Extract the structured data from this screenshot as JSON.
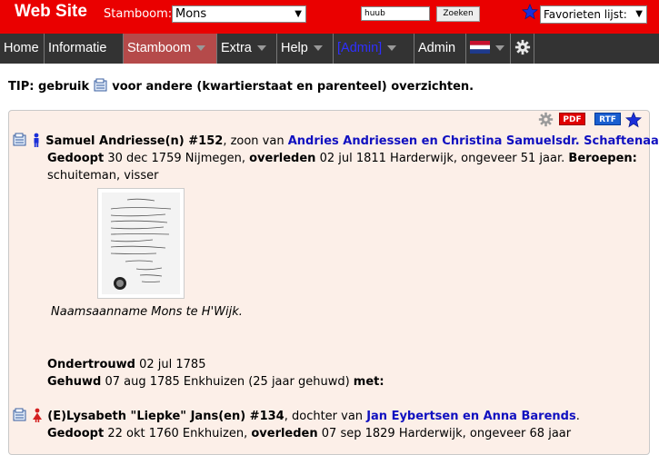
{
  "header": {
    "site_title": "Web Site",
    "stamboom_label": "Stamboom:",
    "stamboom_value": "Mons",
    "search_value": "huub",
    "search_button": "Zoeken",
    "favorites_value": "Favorieten lijst:",
    "bg_color": "#ea0000"
  },
  "nav": {
    "items": [
      {
        "label": "Home"
      },
      {
        "label": "Informatie"
      },
      {
        "label": "Stamboom"
      },
      {
        "label": "Extra"
      },
      {
        "label": "Help"
      },
      {
        "label": "[Admin]"
      },
      {
        "label": "Admin"
      }
    ],
    "active": "Stamboom",
    "flag_icon": "dutch-flag-icon",
    "gear_icon": "gear-icon"
  },
  "tip": {
    "prefix": "TIP: gebruik",
    "suffix": "voor andere (kwartierstaat en parenteel) overzichten."
  },
  "panel": {
    "toolbar": {
      "pdf": "PDF",
      "rtf": "RTF"
    },
    "person1": {
      "name": "Samuel Andriesse(n) #152",
      "relation": ", zoon van",
      "parents": "Andries Andriessen en Christina Samuelsdr. Schaftenaar",
      "period": ".",
      "baptized_label": "Gedoopt",
      "baptized_text": "30 dec 1759 Nijmegen,",
      "died_label": "overleden",
      "died_text": "02 jul 1811 Harderwijk, ongeveer 51 jaar.",
      "jobs_label": "Beroepen:",
      "jobs_text": "schuiteman, visser",
      "image_caption": "Naamsaanname Mons te H'Wijk."
    },
    "marriage": {
      "engaged_label": "Ondertrouwd",
      "engaged_text": "02 jul 1785",
      "married_label": "Gehuwd",
      "married_text": "07 aug 1785 Enkhuizen (25 jaar gehuwd)",
      "with_label": "met:"
    },
    "person2": {
      "name": "(E)Lysabeth \"Liepke\" Jans(en) #134",
      "relation": ", dochter van",
      "parents": "Jan Eybertsen en Anna Barends",
      "period": ".",
      "baptized_label": "Gedoopt",
      "baptized_text": "22 okt 1760 Enkhuizen,",
      "died_label": "overleden",
      "died_text": "07 sep 1829 Harderwijk, ongeveer 68 jaar"
    }
  }
}
